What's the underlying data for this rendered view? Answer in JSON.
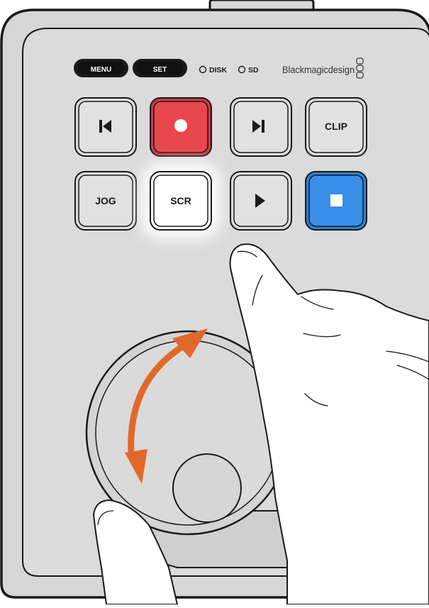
{
  "colors": {
    "device_body": "#d7d7d8",
    "outline": "#1a1a1a",
    "key_face": "#dcdcdd",
    "record_red": "#e8474c",
    "stop_blue": "#3a8fe8",
    "arrow_orange": "#e0692a",
    "hand_fill": "#ffffff"
  },
  "top_buttons": {
    "menu": "MENU",
    "set": "SET"
  },
  "indicators": {
    "disk": "DISK",
    "sd": "SD"
  },
  "brand": {
    "name": "Blackmagicdesign"
  },
  "keys": {
    "prev_icon": "skip-previous-icon",
    "record_icon": "record-icon",
    "next_icon": "skip-next-icon",
    "clip": "CLIP",
    "jog": "JOG",
    "scr": "SCR",
    "play_icon": "play-icon",
    "stop_icon": "stop-icon"
  },
  "highlighted_key": "SCR",
  "wheel": {
    "rotation_arrow": "double-headed-curved-arrow"
  }
}
